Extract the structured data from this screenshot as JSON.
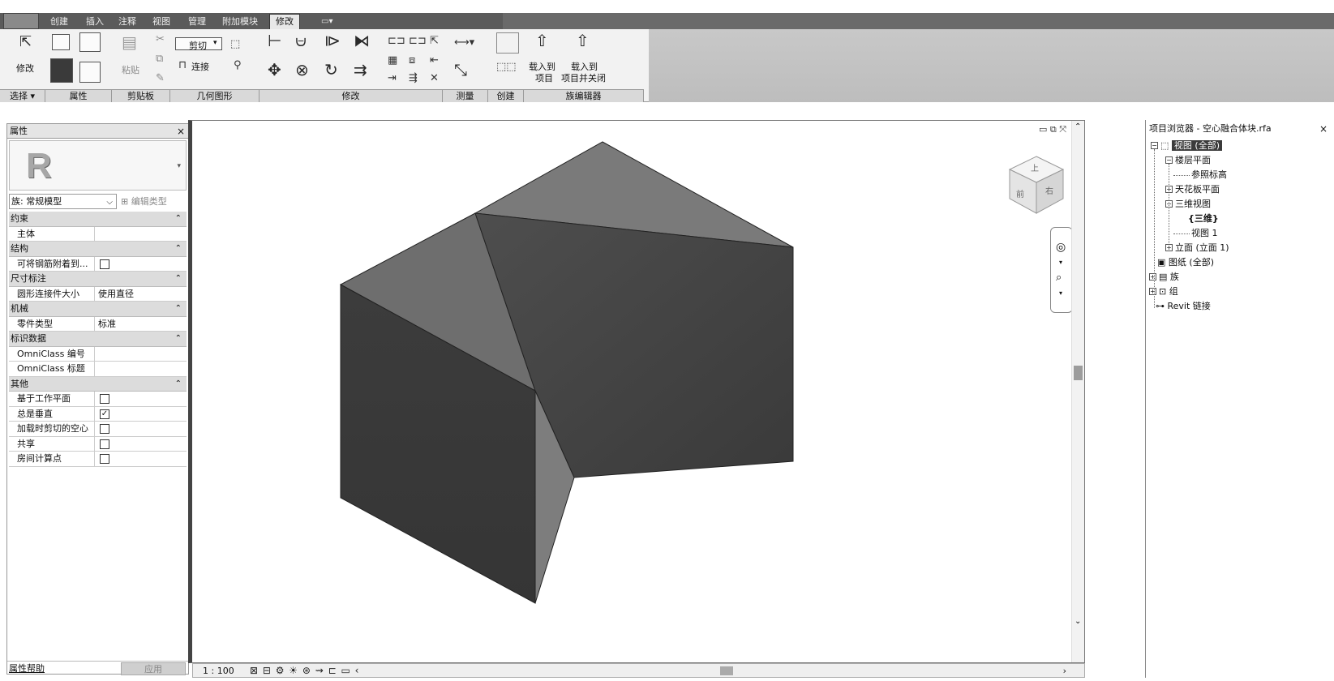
{
  "ribbon": {
    "tabs": [
      "创建",
      "插入",
      "注释",
      "视图",
      "管理",
      "附加模块",
      "修改"
    ],
    "active_tab": "修改",
    "panels": [
      {
        "label": "选择 ▾"
      },
      {
        "label": "属性"
      },
      {
        "label": "剪贴板"
      },
      {
        "label": "几何图形"
      },
      {
        "label": "修改"
      },
      {
        "label": "测量"
      },
      {
        "label": "创建"
      },
      {
        "label": "族编辑器"
      }
    ],
    "modify_button": "修改",
    "paste_label": "粘贴",
    "cut_label": "剪切",
    "join_label": "连接",
    "load_into_project_line1": "载入到",
    "load_into_project_line2": "项目",
    "load_close_line1": "载入到",
    "load_close_line2": "项目并关闭"
  },
  "properties": {
    "title": "属性",
    "family": "族: 常规模型",
    "edit_type": "编辑类型",
    "categories": [
      {
        "name": "约束",
        "rows": [
          {
            "key": "主体",
            "value": ""
          }
        ]
      },
      {
        "name": "结构",
        "rows": [
          {
            "key": "可将钢筋附着到...",
            "checkbox": false
          }
        ]
      },
      {
        "name": "尺寸标注",
        "rows": [
          {
            "key": "圆形连接件大小",
            "value": "使用直径"
          }
        ]
      },
      {
        "name": "机械",
        "rows": [
          {
            "key": "零件类型",
            "value": "标准"
          }
        ]
      },
      {
        "name": "标识数据",
        "rows": [
          {
            "key": "OmniClass 编号",
            "value": ""
          },
          {
            "key": "OmniClass 标题",
            "value": ""
          }
        ]
      },
      {
        "name": "其他",
        "rows": [
          {
            "key": "基于工作平面",
            "checkbox": false
          },
          {
            "key": "总是垂直",
            "checkbox": true
          },
          {
            "key": "加载时剪切的空心",
            "checkbox": false
          },
          {
            "key": "共享",
            "checkbox": false
          },
          {
            "key": "房间计算点",
            "checkbox": false
          }
        ]
      }
    ],
    "help_link": "属性帮助",
    "apply_button": "应用"
  },
  "view": {
    "scale": "1 : 100",
    "viewcube_top": "上",
    "viewcube_front": "前",
    "viewcube_right": "右"
  },
  "browser": {
    "title": "项目浏览器 - 空心融合体块.rfa",
    "nodes": {
      "views_all": "视图 (全部)",
      "floor_plans": "楼层平面",
      "ref_level": "参照标高",
      "ceiling_plans": "天花板平面",
      "views_3d": "三维视图",
      "view_3d_default": "{三维}",
      "view_1": "视图 1",
      "elevations": "立面 (立面 1)",
      "sheets": "图纸 (全部)",
      "families": "族",
      "groups": "组",
      "revit_links": "Revit 链接"
    }
  },
  "colors": {
    "annotation_arrow": "#e8187d",
    "solid_top": "#6d6d6d",
    "solid_left": "#3a3a3a",
    "solid_right": "#4a4a4a"
  }
}
